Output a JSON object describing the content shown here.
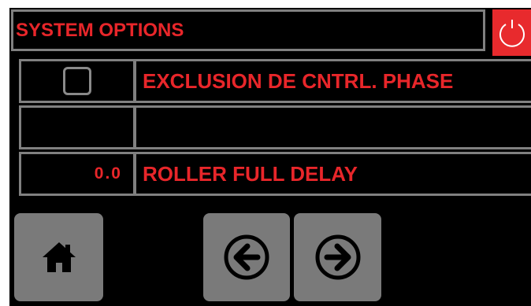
{
  "header": {
    "title": "SYSTEM OPTIONS",
    "power_icon": "power-icon",
    "power_color": "#e82a2d"
  },
  "rows": [
    {
      "control": "checkbox",
      "checked": false,
      "label": "EXCLUSION DE CNTRL. PHASE"
    },
    {
      "control": "empty",
      "label": ""
    },
    {
      "control": "value",
      "value": "0.0",
      "label": "ROLLER FULL DELAY"
    }
  ],
  "footer": {
    "home_icon": "home-icon",
    "prev_icon": "arrow-left-circle-icon",
    "next_icon": "arrow-right-circle-icon"
  },
  "colors": {
    "text_accent": "#e8262a",
    "border": "#808080",
    "button": "#7a7a7a",
    "background": "#000000"
  }
}
